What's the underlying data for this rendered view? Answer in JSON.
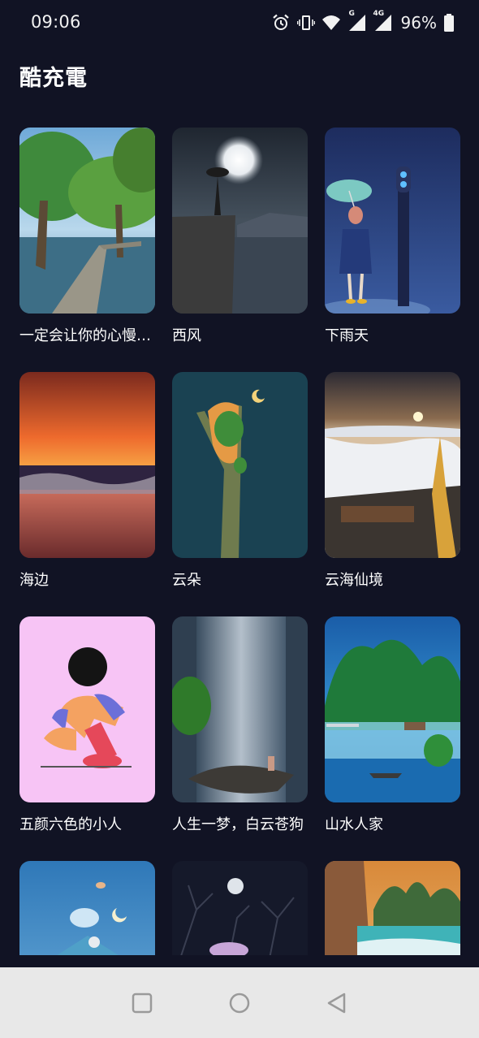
{
  "status_bar": {
    "time": "09:06",
    "battery_percent": "96%",
    "network_label_g": "G",
    "network_label_4g": "4G",
    "icons": [
      "alarm-icon",
      "vibrate-icon",
      "wifi-icon",
      "signal-icon",
      "signal-4g-icon",
      "battery-icon"
    ]
  },
  "header": {
    "title": "酷充電"
  },
  "wallpapers": [
    {
      "title": "一定会让你的心慢慢安静下来"
    },
    {
      "title": "西风"
    },
    {
      "title": "下雨天"
    },
    {
      "title": "海边"
    },
    {
      "title": "云朵"
    },
    {
      "title": "云海仙境"
    },
    {
      "title": "五颜六色的小人"
    },
    {
      "title": "人生一梦，白云苍狗"
    },
    {
      "title": "山水人家"
    },
    {
      "title": ""
    },
    {
      "title": ""
    },
    {
      "title": ""
    }
  ],
  "nav_bar": {
    "buttons": [
      "recents-button",
      "home-button",
      "back-button"
    ]
  },
  "colors": {
    "background": "#111324",
    "nav_bar": "#e8e8e8",
    "nav_icon": "#9a9a9a"
  }
}
